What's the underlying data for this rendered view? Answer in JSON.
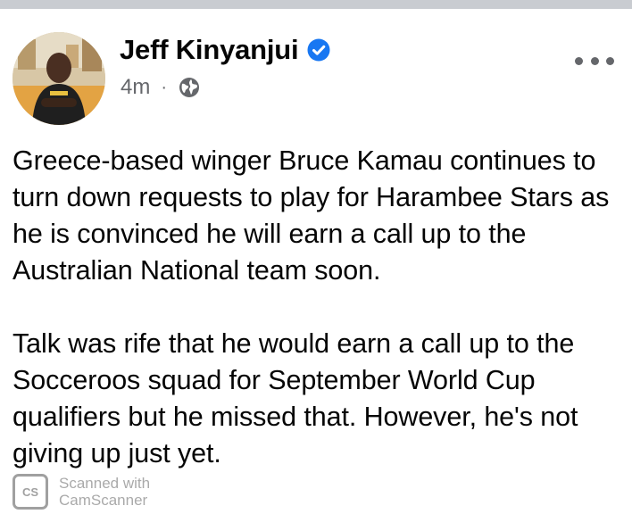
{
  "post": {
    "author": {
      "name": "Jeff Kinyanjui",
      "verified": true,
      "avatar": "profile-photo"
    },
    "timestamp": "4m",
    "separator": "·",
    "privacy_icon": "globe-icon",
    "menu_icon": "more-options-icon",
    "paragraphs": [
      "Greece-based winger Bruce Kamau continues to turn down requests to play for Harambee Stars as he is convinced he will earn a call up to the Australian National team soon.",
      "Talk was rife that he would earn a call up to the Socceroos squad for September World Cup qualifiers but he missed that. However, he's not giving up just yet."
    ]
  },
  "watermark": {
    "logo_text": "CS",
    "line1": "Scanned with",
    "line2": "CamScanner"
  },
  "colors": {
    "verified": "#1877f2",
    "secondary_text": "#65676b",
    "top_bar": "#c9ccd1"
  }
}
